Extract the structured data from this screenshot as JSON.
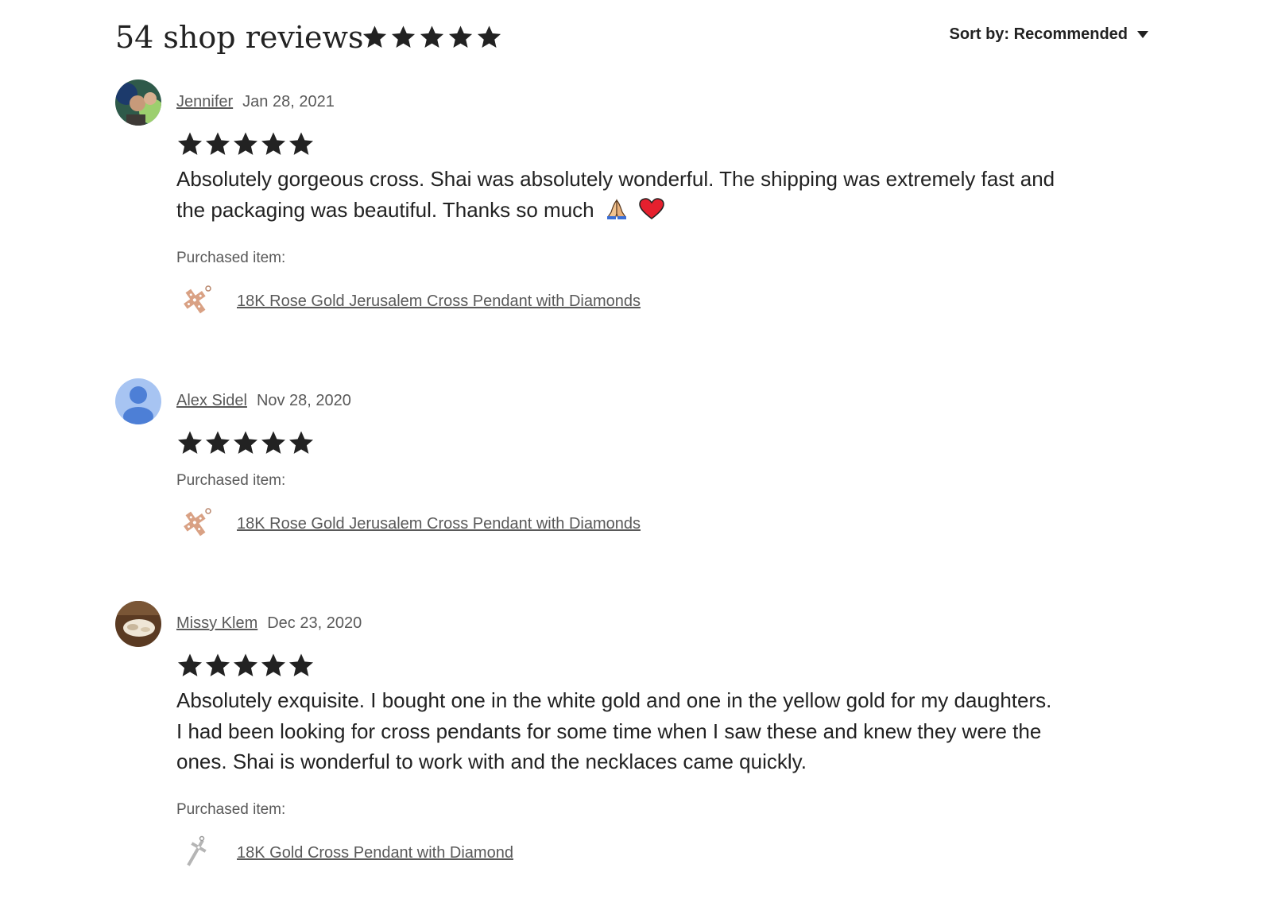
{
  "header": {
    "title": "54 shop reviews",
    "rating": 5,
    "sort_label": "Sort by: Recommended"
  },
  "purchased_label": "Purchased item:",
  "reviews": [
    {
      "name": "Jennifer",
      "date": "Jan 28, 2021",
      "rating": 5,
      "text": "Absolutely gorgeous cross. Shai was absolutely wonderful. The shipping was extremely fast and the packaging was beautiful. Thanks so much",
      "emojis": [
        "folded-hands-icon",
        "red-heart-icon"
      ],
      "item": "18K Rose Gold Jerusalem Cross Pendant with Diamonds"
    },
    {
      "name": "Alex Sidel",
      "date": "Nov 28, 2020",
      "rating": 5,
      "text": "",
      "item": "18K Rose Gold Jerusalem Cross Pendant with Diamonds"
    },
    {
      "name": "Missy Klem",
      "date": "Dec 23, 2020",
      "rating": 5,
      "text": "Absolutely exquisite. I bought one in the white gold and one in the yellow gold for my daughters. I had been looking for cross pendants for some time when I saw these and knew they were the ones. Shai is wonderful to work with and the necklaces came quickly.",
      "item": "18K Gold Cross Pendant with Diamond"
    }
  ],
  "colors": {
    "text": "#222222",
    "muted": "#595959",
    "star": "#222222",
    "default_avatar_bg": "#a7c4f2",
    "default_avatar_fg": "#4d7fd6"
  }
}
